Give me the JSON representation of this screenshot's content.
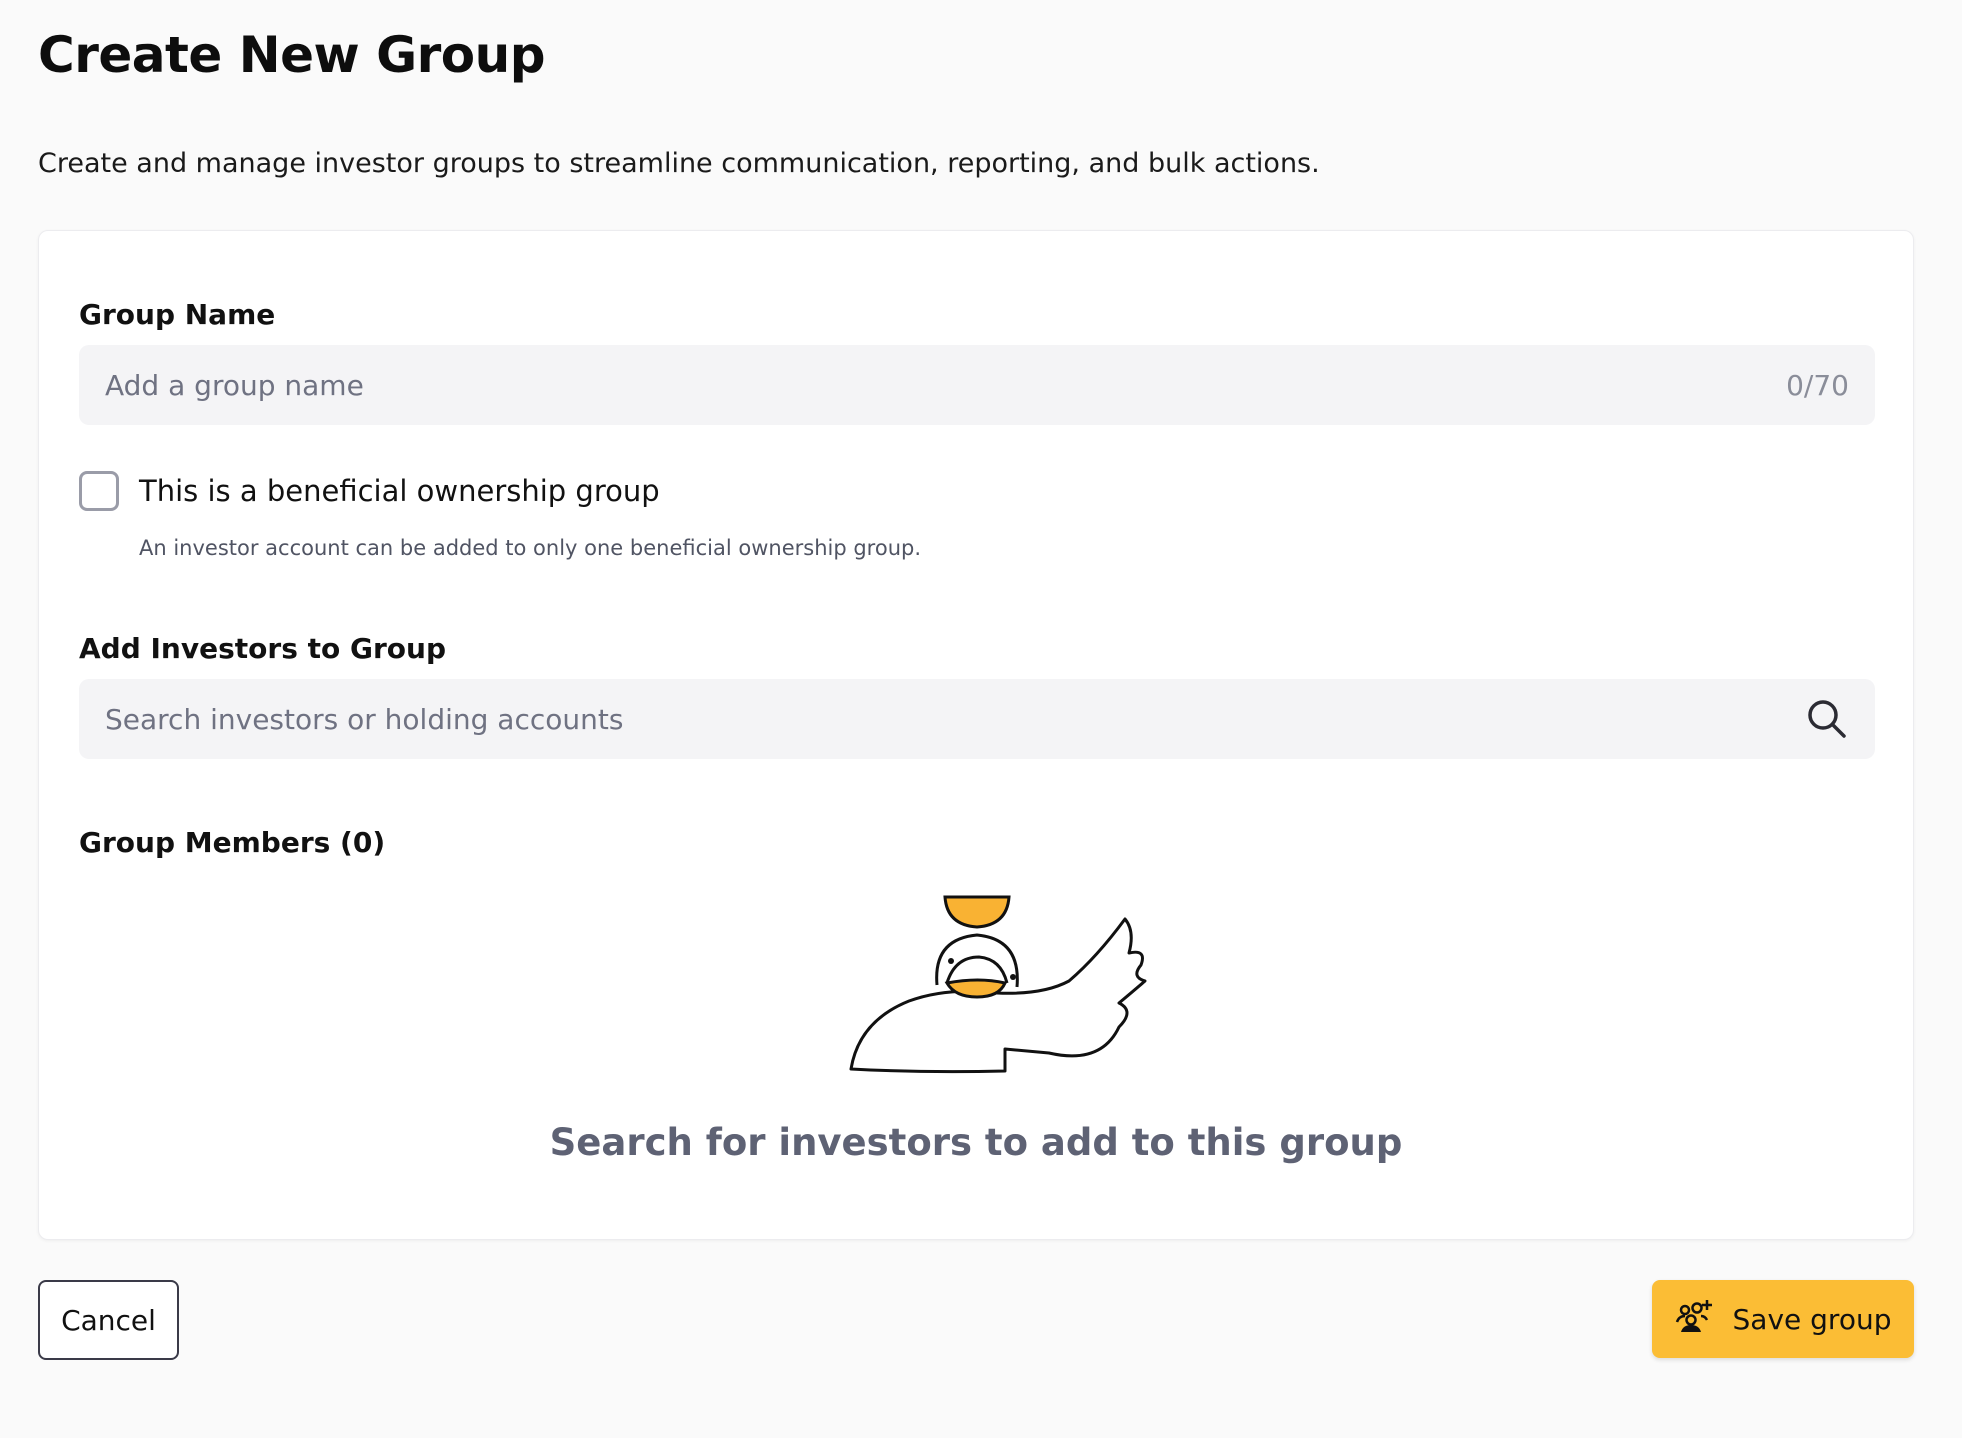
{
  "page": {
    "title": "Create New Group",
    "description": "Create and manage investor groups to streamline communication, reporting, and bulk actions."
  },
  "form": {
    "group_name": {
      "label": "Group Name",
      "placeholder": "Add a group name",
      "value": "",
      "char_count": "0/70"
    },
    "beneficial": {
      "label": "This is a beneficial ownership group",
      "help": "An investor account can be added to only one beneficial ownership group.",
      "checked": false
    },
    "add_investors": {
      "label": "Add Investors to Group",
      "placeholder": "Search investors or holding accounts",
      "icon": "search-icon"
    },
    "members": {
      "label": "Group Members (0)",
      "empty_text": "Search for investors to add to this group",
      "illustration": "bird-balancing-bowl-illustration"
    }
  },
  "actions": {
    "cancel_label": "Cancel",
    "save_label": "Save group",
    "save_icon": "add-group-icon"
  },
  "colors": {
    "accent": "#fbbd35",
    "field_bg": "#f4f4f6",
    "muted_text": "#5e6274"
  }
}
